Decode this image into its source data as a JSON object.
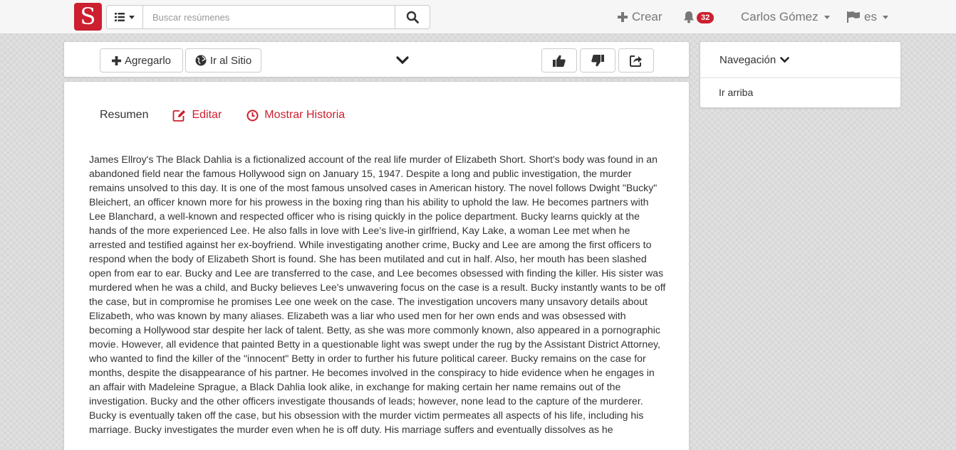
{
  "brand": {
    "logo_letter": "S",
    "color": "#cc1f2f"
  },
  "search": {
    "placeholder": "Buscar resúmenes",
    "value": ""
  },
  "header": {
    "create_label": "Crear",
    "notifications_count": "32",
    "user_name": "Carlos Gómez",
    "language": "es"
  },
  "toolbar": {
    "add_label": "Agregarlo",
    "goto_site_label": "Ir al Sitio"
  },
  "tabs": {
    "summary_label": "Resumen",
    "edit_label": "Editar",
    "history_label": "Mostrar Historia"
  },
  "summary": {
    "text": "James Ellroy's The Black Dahlia is a fictionalized account of the real life murder of Elizabeth Short. Short's body was found in an abandoned field near the famous Hollywood sign on January 15, 1947. Despite a long and public investigation, the murder remains unsolved to this day. It is one of the most famous unsolved cases in American history. The novel follows Dwight \"Bucky\" Bleichert, an officer known more for his prowess in the boxing ring than his ability to uphold the law. He becomes partners with Lee Blanchard, a well-known and respected officer who is rising quickly in the police department. Bucky learns quickly at the hands of the more experienced Lee. He also falls in love with Lee's live-in girlfriend, Kay Lake, a woman Lee met when he arrested and testified against her ex-boyfriend. While investigating another crime, Bucky and Lee are among the first officers to respond when the body of Elizabeth Short is found. She has been mutilated and cut in half. Also, her mouth has been slashed open from ear to ear. Bucky and Lee are transferred to the case, and Lee becomes obsessed with finding the killer. His sister was murdered when he was a child, and Bucky believes Lee's unwavering focus on the case is a result. Bucky instantly wants to be off the case, but in compromise he promises Lee one week on the case. The investigation uncovers many unsavory details about Elizabeth, who was known by many aliases. Elizabeth was a liar who used men for her own ends and was obsessed with becoming a Hollywood star despite her lack of talent. Betty, as she was more commonly known, also appeared in a pornographic movie. However, all evidence that painted Betty in a questionable light was swept under the rug by the Assistant District Attorney, who wanted to find the killer of the \"innocent\" Betty in order to further his future political career. Bucky remains on the case for months, despite the disappearance of his partner. He becomes involved in the conspiracy to hide evidence when he engages in an affair with Madeleine Sprague, a Black Dahlia look alike, in exchange for making certain her name remains out of the investigation. Bucky and the other officers investigate thousands of leads; however, none lead to the capture of the murderer. Bucky is eventually taken off the case, but his obsession with the murder victim permeates all aspects of his life, including his marriage. Bucky investigates the murder even when he is off duty. His marriage suffers and eventually dissolves as he"
  },
  "sidebar": {
    "nav_title": "Navegación",
    "go_top_label": "Ir arriba"
  },
  "icons": {
    "list": "list-icon",
    "search": "search-icon",
    "plus": "plus-icon",
    "bell": "bell-icon",
    "flag": "flag-icon",
    "globe": "globe-icon",
    "chevron": "chevron-down-icon",
    "thumbs_up": "thumbs-up-icon",
    "thumbs_down": "thumbs-down-icon",
    "share": "share-icon",
    "edit": "edit-icon",
    "clock": "clock-icon"
  }
}
